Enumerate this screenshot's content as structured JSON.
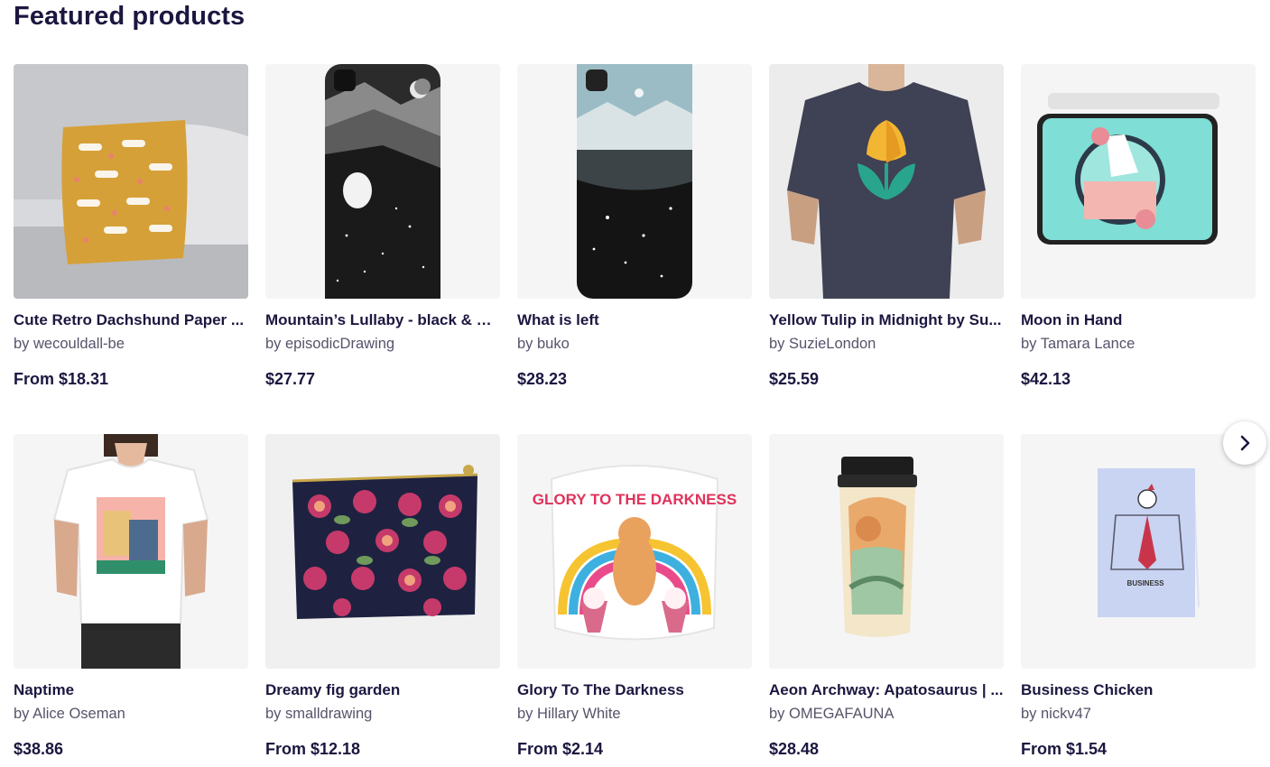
{
  "section": {
    "title": "Featured products"
  },
  "products": [
    {
      "title": "Cute Retro Dachshund Paper ...",
      "artist": "by wecouldall-be",
      "price": "From $18.31",
      "image_icon": "throw-pillow"
    },
    {
      "title": "Mountain’s Lullaby - black & w...",
      "artist": "by episodicDrawing",
      "price": "$27.77",
      "image_icon": "phone-case"
    },
    {
      "title": "What is left",
      "artist": "by buko",
      "price": "$28.23",
      "image_icon": "phone-case"
    },
    {
      "title": "Yellow Tulip in Midnight by Su...",
      "artist": "by SuzieLondon",
      "price": "$25.59",
      "image_icon": "t-shirt"
    },
    {
      "title": "Moon in Hand",
      "artist": "by Tamara Lance",
      "price": "$42.13",
      "image_icon": "laptop-sleeve"
    },
    {
      "title": "Naptime",
      "artist": "by Alice Oseman",
      "price": "$38.86",
      "image_icon": "fitted-t-shirt"
    },
    {
      "title": "Dreamy fig garden",
      "artist": "by smalldrawing",
      "price": "From $12.18",
      "image_icon": "zipper-pouch"
    },
    {
      "title": "Glory To The Darkness",
      "artist": "by Hillary White",
      "price": "From $2.14",
      "image_icon": "sticker"
    },
    {
      "title": "Aeon Archway: Apatosaurus | ...",
      "artist": "by OMEGAFAUNA",
      "price": "$28.48",
      "image_icon": "travel-mug"
    },
    {
      "title": "Business Chicken",
      "artist": "by nickv47",
      "price": "From $1.54",
      "image_icon": "greeting-card"
    }
  ],
  "artwork_text": {
    "sticker_text": "GLORY TO THE DARKNESS",
    "card_text": "BUSINESS"
  },
  "carousel": {
    "next_icon": "chevron-right-icon"
  },
  "colors": {
    "heading": "#1b1740",
    "artist": "#55546a",
    "thumb_bg": "#f5f5f6"
  }
}
